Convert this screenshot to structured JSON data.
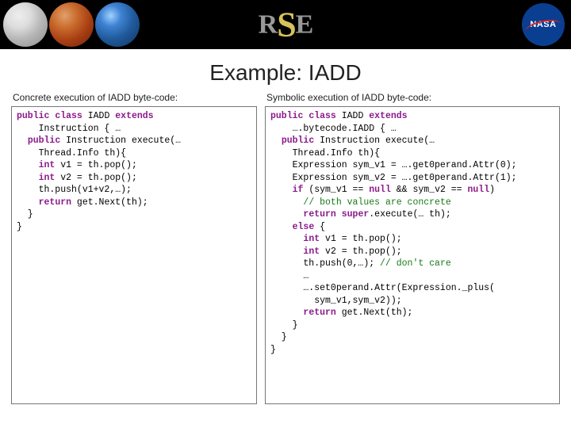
{
  "banner": {
    "logo_r": "R",
    "logo_s": "S",
    "logo_e": "E",
    "nasa_label": "NASA"
  },
  "title": "Example: IADD",
  "left": {
    "caption": "Concrete execution of IADD byte-code:",
    "code": "<span class='kw'>public</span> <span class='kw'>class</span> IADD <span class='kw'>extends</span>\n    Instruction { …\n  <span class='kw'>public</span> Instruction execute(…\n    Thread.Info th){\n    <span class='kw'>int</span> v1 = th.pop();\n    <span class='kw'>int</span> v2 = th.pop();\n    th.push(v1+v2,…);\n    <span class='kw'>return</span> get.Next(th);\n  }\n}"
  },
  "right": {
    "caption": "Symbolic execution of IADD byte-code:",
    "code": "<span class='kw'>public</span> <span class='kw'>class</span> IADD <span class='kw'>extends</span>\n    ….bytecode.IADD { …\n  <span class='kw'>public</span> Instruction execute(…\n    Thread.Info th){\n    Expression sym_v1 = ….get0perand.Attr(0);\n    Expression sym_v2 = ….get0perand.Attr(1);\n    <span class='kw'>if</span> (sym_v1 == <span class='kw'>null</span> && sym_v2 == <span class='kw'>null</span>)\n      <span class='cm'>// both values are concrete</span>\n      <span class='kw'>return</span> <span class='kw'>super</span>.execute(… th);\n    <span class='kw'>else</span> {\n      <span class='kw'>int</span> v1 = th.pop();\n      <span class='kw'>int</span> v2 = th.pop();\n      th.push(0,…); <span class='cm'>// don't care</span>\n      …\n      ….set0perand.Attr(Expression._plus(\n        sym_v1,sym_v2));\n      <span class='kw'>return</span> get.Next(th);\n    }\n  }\n}"
  }
}
